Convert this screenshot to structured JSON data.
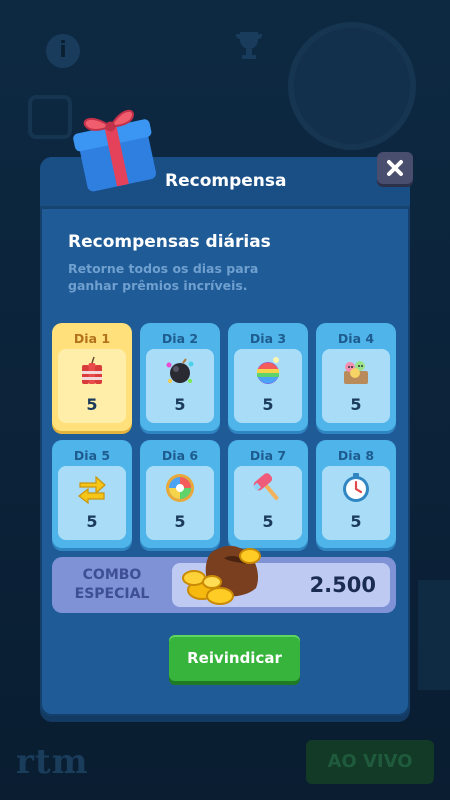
{
  "background": {
    "info_glyph": "i",
    "logo_text": "rtm",
    "live_label": "AO VIVO"
  },
  "modal": {
    "title": "Recompensa",
    "heading": "Recompensas diárias",
    "subtitle": "Retorne todos os dias para ganhar prêmios incríveis.",
    "days": [
      {
        "label": "Dia 1",
        "qty": "5",
        "icon": "firecracker-icon",
        "active": true
      },
      {
        "label": "Dia 2",
        "qty": "5",
        "icon": "bomb-icon",
        "active": false
      },
      {
        "label": "Dia 3",
        "qty": "5",
        "icon": "rainbow-bomb-icon",
        "active": false
      },
      {
        "label": "Dia 4",
        "qty": "5",
        "icon": "candy-box-icon",
        "active": false
      },
      {
        "label": "Dia 5",
        "qty": "5",
        "icon": "swap-arrows-icon",
        "active": false
      },
      {
        "label": "Dia 6",
        "qty": "5",
        "icon": "color-wheel-icon",
        "active": false
      },
      {
        "label": "Dia 7",
        "qty": "5",
        "icon": "hammer-icon",
        "active": false
      },
      {
        "label": "Dia 8",
        "qty": "5",
        "icon": "clock-icon",
        "active": false
      }
    ],
    "combo": {
      "label_line1": "COMBO",
      "label_line2": "ESPECIAL",
      "value": "2.500",
      "icon": "coin-pouch-icon"
    },
    "claim_label": "Reivindicar",
    "close_icon": "close-icon"
  },
  "colors": {
    "modal": "#1f5b97",
    "day_card": "#4fb4ea",
    "day_active": "#ffe07a",
    "claim_button": "#37b43c",
    "combo": "#7f92d6"
  }
}
